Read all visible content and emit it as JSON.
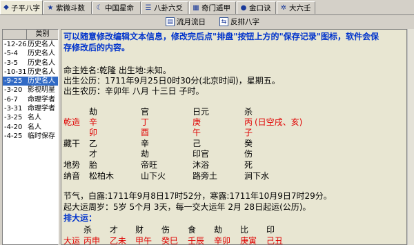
{
  "tabs": [
    {
      "label": "子平八字",
      "icon": "chart-icon"
    },
    {
      "label": "紫微斗数",
      "icon": "star-icon"
    },
    {
      "label": "中国星命",
      "icon": "moon-icon"
    },
    {
      "label": "八卦六爻",
      "icon": "bagua-icon"
    },
    {
      "label": "奇门遁甲",
      "icon": "grid-icon"
    },
    {
      "label": "金口诀",
      "icon": "coin-icon"
    },
    {
      "label": "大六壬",
      "icon": "wheel-icon"
    }
  ],
  "toolbar": {
    "liuyue": "流月流日",
    "fanpai": "反排八字"
  },
  "list": {
    "header": "类别",
    "rows": [
      {
        "date": "-12-26",
        "cat": "历史名人"
      },
      {
        "date": "-5-4",
        "cat": "历史名人"
      },
      {
        "date": "-3-5",
        "cat": "历史名人"
      },
      {
        "date": "-10-31",
        "cat": "历史名人"
      },
      {
        "date": "-9-25",
        "cat": "历史名人"
      },
      {
        "date": "-3-20",
        "cat": "影视明星"
      },
      {
        "date": "-6-7",
        "cat": "命理学者"
      },
      {
        "date": "-3-31",
        "cat": "命理学者"
      },
      {
        "date": "-3-25",
        "cat": "名人"
      },
      {
        "date": "-4-20",
        "cat": "名人"
      },
      {
        "date": "-4-25",
        "cat": "临时保存"
      }
    ]
  },
  "content": {
    "notice1": "可以随意修改编辑文本信息，修改完后点\"排盘\"按钮上方的\"保存记录\"图标，软件会保",
    "notice2": "存修改后的内容。",
    "name_line": "命主姓名:乾隆   出生地:未知。",
    "solar_line": "出生公历：1711年9月25日0时30分(北京时间)，星期五。",
    "lunar_line": "出生农历：辛卯年 八月 十三日 子时。",
    "shishen": [
      "劫",
      "官",
      "日元",
      "杀"
    ],
    "qianzao_label": "乾造",
    "gan": [
      "辛",
      "丁",
      "庚",
      "丙"
    ],
    "kongwang": "(日空戌、亥)",
    "zhi": [
      "卯",
      "酉",
      "午",
      "子"
    ],
    "canggan_label": "藏干",
    "canggan1": [
      "乙",
      "辛",
      "己",
      "癸"
    ],
    "canggan2": [
      "才",
      "劫",
      "印官",
      "伤"
    ],
    "dishi_label": "地势",
    "dishi": [
      "胎",
      "帝旺",
      "沐浴",
      "死"
    ],
    "nayin_label": "纳音",
    "nayin": [
      "松柏木",
      "山下火",
      "路旁土",
      "涧下水"
    ],
    "jieqi_line": "节气，白露:1711年9月8日17时52分，寒露:1711年10月9日7时29分。",
    "qiyun_line": "起大运周岁：5岁 5个月 3天，每一交大运年 2月 28日起运(公历)。",
    "pai_dayun": "排大运：",
    "dayun_shishen": [
      "杀",
      "才",
      "财",
      "伤",
      "食",
      "劫",
      "比",
      "印"
    ],
    "dayun_label": "大运",
    "dayun": [
      "丙申",
      "乙未",
      "甲午",
      "癸巳",
      "壬辰",
      "辛卯",
      "庚寅",
      "己丑"
    ]
  }
}
